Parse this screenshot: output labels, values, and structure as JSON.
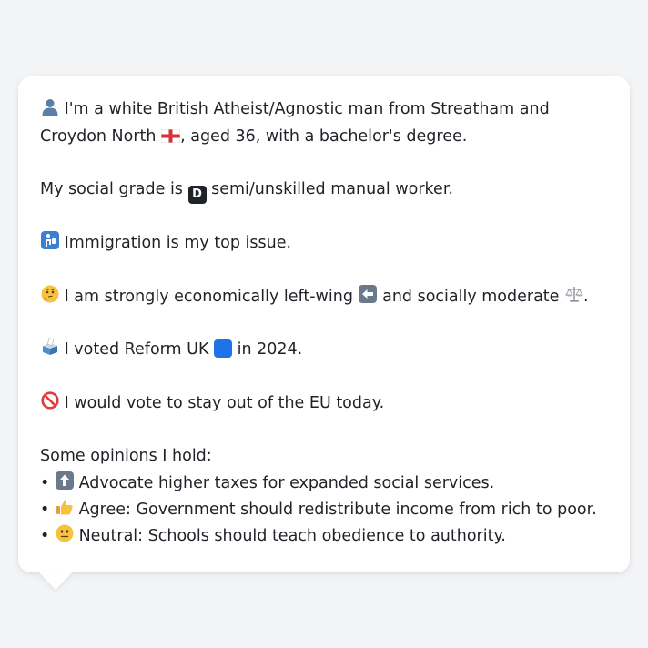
{
  "profile": {
    "intro_pre": "I'm a white British Atheist/Agnostic man from Streatham and Croydon North",
    "intro_post": ", aged 36, with a bachelor's degree.",
    "social_grade_pre": "My social grade is",
    "social_grade_letter": "D",
    "social_grade_post": "semi/unskilled manual worker.",
    "top_issue": "Immigration is my top issue.",
    "ideology_pre": "I am strongly economically left-wing",
    "ideology_mid": "and socially moderate",
    "ideology_end": ".",
    "vote_pre": "I voted Reform UK",
    "vote_post": "in 2024.",
    "eu_vote": "I would vote to stay out of the EU today."
  },
  "opinions": {
    "heading": "Some opinions I hold:",
    "bullet_char": "•",
    "items": [
      {
        "icon": "up-arrow-icon",
        "text": "Advocate higher taxes for expanded social services."
      },
      {
        "icon": "thumbs-up-icon",
        "text": "Agree: Government should redistribute income from rich to poor."
      },
      {
        "icon": "neutral-face-icon",
        "text": "Neutral: Schools should teach obedience to authority."
      }
    ]
  },
  "colors": {
    "page_bg": "#f3f4f6",
    "bubble_bg": "#ffffff",
    "text": "#1f2328",
    "key_blue": "#3b7fd4",
    "reform_blue": "#1e73e8",
    "grade_box": "#1f2328"
  }
}
